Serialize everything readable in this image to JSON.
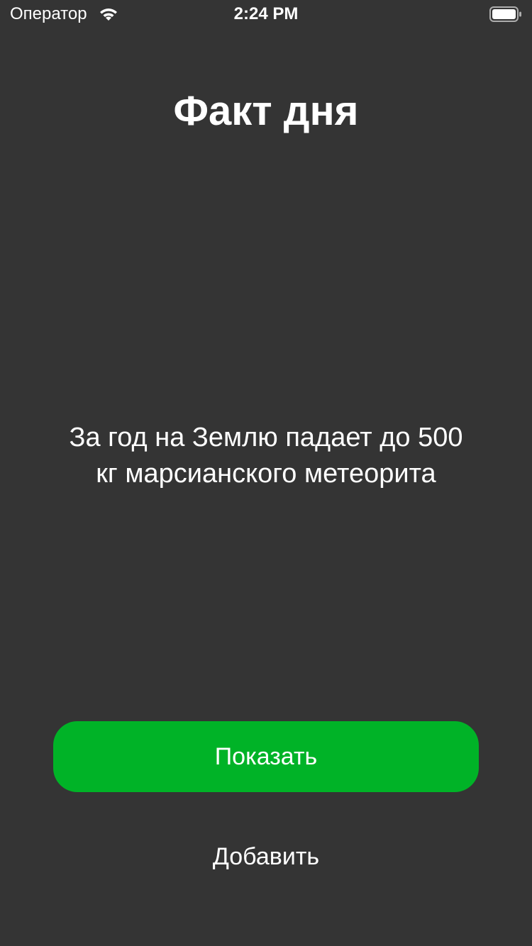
{
  "status_bar": {
    "carrier": "Оператор",
    "time": "2:24 PM",
    "wifi_icon": "wifi-icon",
    "battery_icon": "battery-icon"
  },
  "screen": {
    "title": "Факт дня",
    "fact": "За год на Землю падает до 500 кг марсианского метеорита"
  },
  "actions": {
    "show_label": "Показать",
    "add_label": "Добавить"
  },
  "colors": {
    "background": "#343434",
    "accent": "#00b327",
    "text": "#ffffff"
  }
}
